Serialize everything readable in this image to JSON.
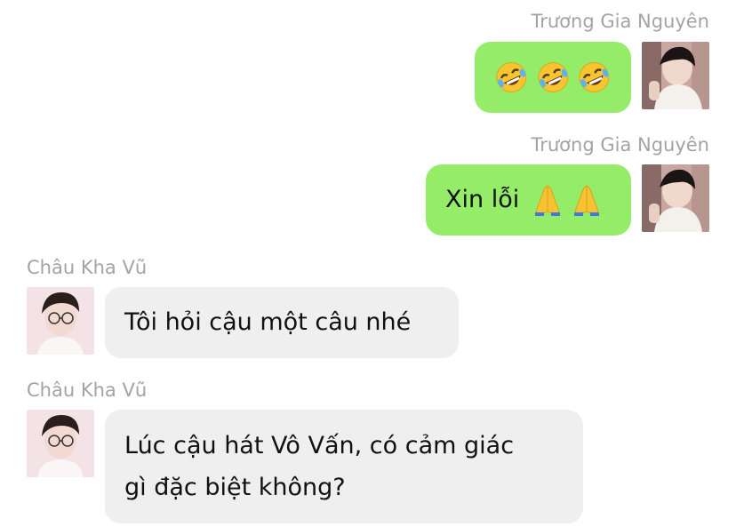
{
  "messages": [
    {
      "sender": "Trương Gia Nguyên",
      "side": "right",
      "text": "",
      "emoji": [
        "rofl-emoji",
        "rofl-emoji",
        "rofl-emoji"
      ]
    },
    {
      "sender": "Trương Gia Nguyên",
      "side": "right",
      "text": "Xin lỗi",
      "emoji": [
        "folded-hands-emoji",
        "folded-hands-emoji"
      ]
    },
    {
      "sender": "Châu Kha Vũ",
      "side": "left",
      "text": "Tôi hỏi cậu một câu nhé"
    },
    {
      "sender": "Châu Kha Vũ",
      "side": "left",
      "text_line1": "Lúc cậu hát Vô Vấn, có cảm giác",
      "text_line2": "gì đặc biệt không?"
    }
  ],
  "colors": {
    "outgoing_bubble": "#95ec69",
    "incoming_bubble": "#efefef",
    "sender_name": "#a3a3a3"
  }
}
